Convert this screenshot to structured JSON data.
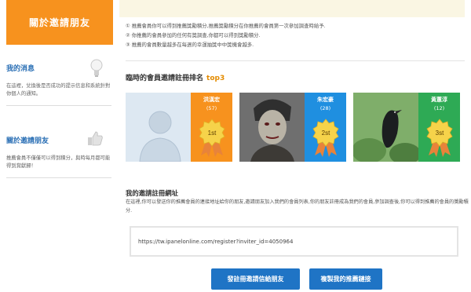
{
  "sidebar": {
    "header": "關於邀請朋友",
    "sections": [
      {
        "title": "我的消息",
        "text": "在這裡，兌換後是否成功的提示信息和系統針對你個人的通知。",
        "icon": "lightbulb-icon"
      },
      {
        "title": "關於邀請朋友",
        "text": "推薦會員不僅僅可以得到積分，與時每月都可能得到賞獻歸！",
        "icon": "thumbs-up-icon"
      }
    ]
  },
  "rules": [
    "① 推薦會員你可以得到推薦獎勵積分,推薦獎勵積分在你推薦的會員第一次參加調查時給予.",
    "② 你推薦的會員參加的任何有獎調查,你都可以得到獎勵積分.",
    "③ 推薦的會員數量越多在每週的幸運抽獎中中獎機會越多."
  ],
  "ranking": {
    "title": "臨時的會員邀請註冊排名",
    "badge": "top3",
    "cards": [
      {
        "name": "洪漢宏",
        "count": "(57)",
        "rank": "1st",
        "color": "#f7921e",
        "photo": "silhouette"
      },
      {
        "name": "朱宏豪",
        "count": "(28)",
        "rank": "2st",
        "color": "#1f8fe0",
        "photo": "zombie"
      },
      {
        "name": "黃蕙淳",
        "count": "(12)",
        "rank": "3st",
        "color": "#2eaa55",
        "photo": "crow"
      }
    ]
  },
  "link_section": {
    "title": "我的邀請註冊網址",
    "description": "在這裡,你可以發送你的推薦會員的連接地址給你的朋友,邀請朋友加入我們的會員列表,你的朋友註冊成為我們的會員,參加調查後,你可以得到推薦的會員的獎勵積分.",
    "url": "https://tw.ipanelonline.com/register?inviter_id=4050964"
  },
  "buttons": {
    "send": "發註冊邀請信給朋友",
    "copy": "複製我的推薦鏈接"
  }
}
